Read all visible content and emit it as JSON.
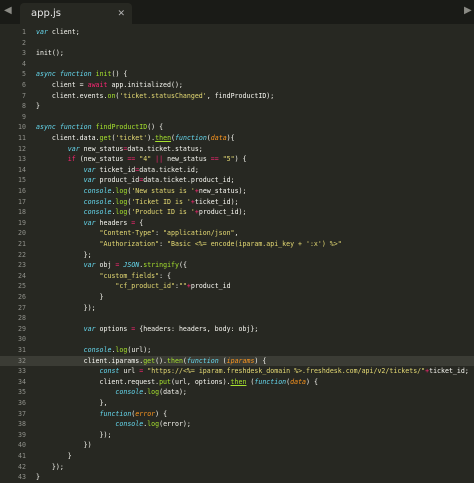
{
  "window": {
    "tab_title": "app.js",
    "close_glyph": "✕"
  },
  "nav": {
    "back": "◀",
    "forward": "▶"
  },
  "active_line": 32,
  "lines": [
    [
      {
        "t": "var",
        "c": "it"
      },
      {
        "t": " client;"
      }
    ],
    [],
    [
      {
        "t": "init();"
      }
    ],
    [],
    [
      {
        "t": "async",
        "c": "it"
      },
      {
        "t": " "
      },
      {
        "t": "function",
        "c": "it"
      },
      {
        "t": " "
      },
      {
        "t": "init",
        "c": "fn"
      },
      {
        "t": "() {"
      }
    ],
    [
      {
        "t": "    client = "
      },
      {
        "t": "await",
        "c": "kw"
      },
      {
        "t": " app.initialized();"
      }
    ],
    [
      {
        "t": "    client.events."
      },
      {
        "t": "on",
        "c": "fn"
      },
      {
        "t": "("
      },
      {
        "t": "'ticket.statusChanged'",
        "c": "str"
      },
      {
        "t": ", findProductID);"
      }
    ],
    [
      {
        "t": "}"
      }
    ],
    [],
    [
      {
        "t": "async",
        "c": "it"
      },
      {
        "t": " "
      },
      {
        "t": "function",
        "c": "it"
      },
      {
        "t": " "
      },
      {
        "t": "findProductID",
        "c": "fn"
      },
      {
        "t": "() {"
      }
    ],
    [
      {
        "t": "    client.data."
      },
      {
        "t": "get",
        "c": "fn"
      },
      {
        "t": "("
      },
      {
        "t": "'ticket'",
        "c": "str"
      },
      {
        "t": ")."
      },
      {
        "t": "then",
        "c": "fn under"
      },
      {
        "t": "("
      },
      {
        "t": "function",
        "c": "it"
      },
      {
        "t": "("
      },
      {
        "t": "data",
        "c": "arg"
      },
      {
        "t": "){"
      }
    ],
    [
      {
        "t": "        "
      },
      {
        "t": "var",
        "c": "it"
      },
      {
        "t": " new_status"
      },
      {
        "t": "=",
        "c": "kw"
      },
      {
        "t": "data.ticket.status;"
      }
    ],
    [
      {
        "t": "        "
      },
      {
        "t": "if",
        "c": "kw"
      },
      {
        "t": " (new_status "
      },
      {
        "t": "==",
        "c": "kw"
      },
      {
        "t": " "
      },
      {
        "t": "\"4\"",
        "c": "str"
      },
      {
        "t": " "
      },
      {
        "t": "||",
        "c": "kw"
      },
      {
        "t": " new_status "
      },
      {
        "t": "==",
        "c": "kw"
      },
      {
        "t": " "
      },
      {
        "t": "\"5\"",
        "c": "str"
      },
      {
        "t": ") {"
      }
    ],
    [
      {
        "t": "            "
      },
      {
        "t": "var",
        "c": "it"
      },
      {
        "t": " ticket_id"
      },
      {
        "t": "=",
        "c": "kw"
      },
      {
        "t": "data.ticket.id;"
      }
    ],
    [
      {
        "t": "            "
      },
      {
        "t": "var",
        "c": "it"
      },
      {
        "t": " product_id"
      },
      {
        "t": "=",
        "c": "kw"
      },
      {
        "t": "data.ticket.product_id;"
      }
    ],
    [
      {
        "t": "            "
      },
      {
        "t": "console",
        "c": "it"
      },
      {
        "t": "."
      },
      {
        "t": "log",
        "c": "fn"
      },
      {
        "t": "("
      },
      {
        "t": "'New status is '",
        "c": "str"
      },
      {
        "t": "+",
        "c": "kw"
      },
      {
        "t": "new_status);"
      }
    ],
    [
      {
        "t": "            "
      },
      {
        "t": "console",
        "c": "it"
      },
      {
        "t": "."
      },
      {
        "t": "log",
        "c": "fn"
      },
      {
        "t": "("
      },
      {
        "t": "'Ticket ID is '",
        "c": "str"
      },
      {
        "t": "+",
        "c": "kw"
      },
      {
        "t": "ticket_id);"
      }
    ],
    [
      {
        "t": "            "
      },
      {
        "t": "console",
        "c": "it"
      },
      {
        "t": "."
      },
      {
        "t": "log",
        "c": "fn"
      },
      {
        "t": "("
      },
      {
        "t": "'Product ID is '",
        "c": "str"
      },
      {
        "t": "+",
        "c": "kw"
      },
      {
        "t": "product_id);"
      }
    ],
    [
      {
        "t": "            "
      },
      {
        "t": "var",
        "c": "it"
      },
      {
        "t": " headers "
      },
      {
        "t": "=",
        "c": "kw"
      },
      {
        "t": " {"
      }
    ],
    [
      {
        "t": "                "
      },
      {
        "t": "\"Content-Type\"",
        "c": "str"
      },
      {
        "t": ": "
      },
      {
        "t": "\"application/json\"",
        "c": "str"
      },
      {
        "t": ","
      }
    ],
    [
      {
        "t": "                "
      },
      {
        "t": "\"Authorization\"",
        "c": "str"
      },
      {
        "t": ": "
      },
      {
        "t": "\"Basic <%= encode(iparam.api_key + ':x') %>\"",
        "c": "str"
      }
    ],
    [
      {
        "t": "            };"
      }
    ],
    [
      {
        "t": "            "
      },
      {
        "t": "var",
        "c": "it"
      },
      {
        "t": " obj "
      },
      {
        "t": "=",
        "c": "kw"
      },
      {
        "t": " "
      },
      {
        "t": "JSON",
        "c": "it"
      },
      {
        "t": "."
      },
      {
        "t": "stringify",
        "c": "fn"
      },
      {
        "t": "({"
      }
    ],
    [
      {
        "t": "                "
      },
      {
        "t": "\"custom_fields\"",
        "c": "str"
      },
      {
        "t": ": {"
      }
    ],
    [
      {
        "t": "                    "
      },
      {
        "t": "\"cf_product_id\"",
        "c": "str"
      },
      {
        "t": ":"
      },
      {
        "t": "\"\"",
        "c": "str"
      },
      {
        "t": "+",
        "c": "kw"
      },
      {
        "t": "product_id"
      }
    ],
    [
      {
        "t": "                }"
      }
    ],
    [
      {
        "t": "            });"
      }
    ],
    [],
    [
      {
        "t": "            "
      },
      {
        "t": "var",
        "c": "it"
      },
      {
        "t": " options "
      },
      {
        "t": "=",
        "c": "kw"
      },
      {
        "t": " {headers: headers, body: obj};"
      }
    ],
    [],
    [
      {
        "t": "            "
      },
      {
        "t": "console",
        "c": "it"
      },
      {
        "t": "."
      },
      {
        "t": "log",
        "c": "fn"
      },
      {
        "t": "(url);"
      }
    ],
    [
      {
        "t": "            client.iparams."
      },
      {
        "t": "get",
        "c": "fn"
      },
      {
        "t": "()."
      },
      {
        "t": "then",
        "c": "fn"
      },
      {
        "t": "("
      },
      {
        "t": "function",
        "c": "it"
      },
      {
        "t": " ("
      },
      {
        "t": "iparams",
        "c": "arg"
      },
      {
        "t": ") {"
      }
    ],
    [
      {
        "t": "                "
      },
      {
        "t": "const",
        "c": "it"
      },
      {
        "t": " url "
      },
      {
        "t": "=",
        "c": "kw"
      },
      {
        "t": " "
      },
      {
        "t": "\"https://<%= iparam.freshdesk_domain %>.freshdesk.com/api/v2/tickets/\"",
        "c": "str"
      },
      {
        "t": "+",
        "c": "kw"
      },
      {
        "t": "ticket_id;"
      }
    ],
    [
      {
        "t": "                client.request."
      },
      {
        "t": "put",
        "c": "fn"
      },
      {
        "t": "(url, options)."
      },
      {
        "t": "then",
        "c": "fn under"
      },
      {
        "t": " ("
      },
      {
        "t": "function",
        "c": "it"
      },
      {
        "t": "("
      },
      {
        "t": "data",
        "c": "arg"
      },
      {
        "t": ") {"
      }
    ],
    [
      {
        "t": "                    "
      },
      {
        "t": "console",
        "c": "it"
      },
      {
        "t": "."
      },
      {
        "t": "log",
        "c": "fn"
      },
      {
        "t": "(data);"
      }
    ],
    [
      {
        "t": "                },"
      }
    ],
    [
      {
        "t": "                "
      },
      {
        "t": "function",
        "c": "it"
      },
      {
        "t": "("
      },
      {
        "t": "error",
        "c": "arg"
      },
      {
        "t": ") {"
      }
    ],
    [
      {
        "t": "                    "
      },
      {
        "t": "console",
        "c": "it"
      },
      {
        "t": "."
      },
      {
        "t": "log",
        "c": "fn"
      },
      {
        "t": "(error);"
      }
    ],
    [
      {
        "t": "                });"
      }
    ],
    [
      {
        "t": "            })"
      }
    ],
    [
      {
        "t": "        }"
      }
    ],
    [
      {
        "t": "    });"
      }
    ],
    [
      {
        "t": "}"
      }
    ]
  ]
}
